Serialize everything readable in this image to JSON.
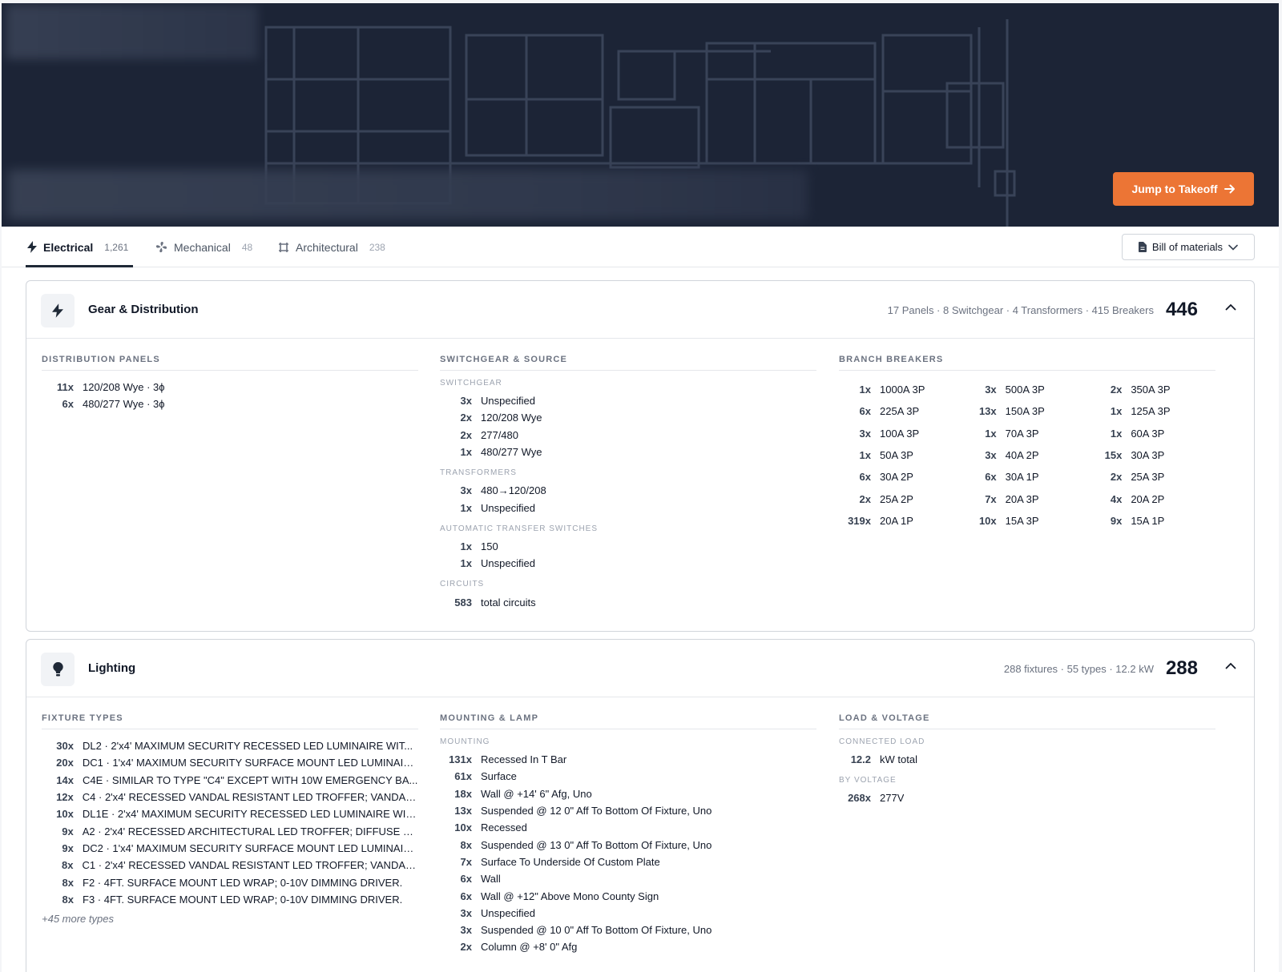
{
  "hero": {
    "jump_label": "Jump to Takeoff"
  },
  "tabs": [
    {
      "label": "Electrical",
      "count": "1,261"
    },
    {
      "label": "Mechanical",
      "count": "48"
    },
    {
      "label": "Architectural",
      "count": "238"
    }
  ],
  "bom_label": "Bill of materials",
  "gear": {
    "title": "Gear & Distribution",
    "summary": "17 Panels · 8 Switchgear · 4 Transformers · 415 Breakers",
    "total": "446",
    "panels_title": "DISTRIBUTION PANELS",
    "panels": [
      {
        "q": "11x",
        "l": "120/208 Wye · 3ϕ"
      },
      {
        "q": "6x",
        "l": "480/277 Wye · 3ϕ"
      }
    ],
    "switch_title": "SWITCHGEAR & SOURCE",
    "switchgear_sub": "SWITCHGEAR",
    "switchgear": [
      {
        "q": "3x",
        "l": "Unspecified"
      },
      {
        "q": "2x",
        "l": "120/208 Wye"
      },
      {
        "q": "2x",
        "l": "277/480"
      },
      {
        "q": "1x",
        "l": "480/277 Wye"
      }
    ],
    "transformers_sub": "TRANSFORMERS",
    "transformers": [
      {
        "q": "3x",
        "l": "480→120/208"
      },
      {
        "q": "1x",
        "l": "Unspecified"
      }
    ],
    "ats_sub": "AUTOMATIC TRANSFER SWITCHES",
    "ats": [
      {
        "q": "1x",
        "l": "150"
      },
      {
        "q": "1x",
        "l": "Unspecified"
      }
    ],
    "circuits_sub": "CIRCUITS",
    "circuits": [
      {
        "q": "583",
        "l": "total circuits"
      }
    ],
    "breakers_title": "BRANCH BREAKERS",
    "breakers": [
      {
        "q": "1x",
        "l": "1000A 3P"
      },
      {
        "q": "3x",
        "l": "500A 3P"
      },
      {
        "q": "2x",
        "l": "350A 3P"
      },
      {
        "q": "6x",
        "l": "225A 3P"
      },
      {
        "q": "13x",
        "l": "150A 3P"
      },
      {
        "q": "1x",
        "l": "125A 3P"
      },
      {
        "q": "3x",
        "l": "100A 3P"
      },
      {
        "q": "1x",
        "l": "70A 3P"
      },
      {
        "q": "1x",
        "l": "60A 3P"
      },
      {
        "q": "1x",
        "l": "50A 3P"
      },
      {
        "q": "3x",
        "l": "40A 2P"
      },
      {
        "q": "15x",
        "l": "30A 3P"
      },
      {
        "q": "6x",
        "l": "30A 2P"
      },
      {
        "q": "6x",
        "l": "30A 1P"
      },
      {
        "q": "2x",
        "l": "25A 3P"
      },
      {
        "q": "2x",
        "l": "25A 2P"
      },
      {
        "q": "7x",
        "l": "20A 3P"
      },
      {
        "q": "4x",
        "l": "20A 2P"
      },
      {
        "q": "319x",
        "l": "20A 1P"
      },
      {
        "q": "10x",
        "l": "15A 3P"
      },
      {
        "q": "9x",
        "l": "15A 1P"
      }
    ]
  },
  "lighting": {
    "title": "Lighting",
    "summary": "288 fixtures · 55 types · 12.2 kW",
    "total": "288",
    "fixtures_title": "FIXTURE TYPES",
    "fixtures": [
      {
        "q": "30x",
        "l": "DL2 · 2'x4' MAXIMUM SECURITY RECESSED LED LUMINAIRE WIT..."
      },
      {
        "q": "20x",
        "l": "DC1 · 1'x4' MAXIMUM SECURITY SURFACE MOUNT LED LUMINAIR..."
      },
      {
        "q": "14x",
        "l": "C4E · SIMILAR TO TYPE \"C4\" EXCEPT WITH 10W EMERGENCY BA..."
      },
      {
        "q": "12x",
        "l": "C4 · 2'x4' RECESSED VANDAL RESISTANT LED TROFFER; VANDAL..."
      },
      {
        "q": "10x",
        "l": "DL1E · 2'x4' MAXIMUM SECURITY RECESSED LED LUMINAIRE WIT..."
      },
      {
        "q": "9x",
        "l": "A2 · 2'x4' RECESSED ARCHITECTURAL LED TROFFER; DIFFUSE M..."
      },
      {
        "q": "9x",
        "l": "DC2 · 1'x4' MAXIMUM SECURITY SURFACE MOUNT LED LUMINAIR..."
      },
      {
        "q": "8x",
        "l": "C1 · 2'x4' RECESSED VANDAL RESISTANT LED TROFFER; VANDAL ..."
      },
      {
        "q": "8x",
        "l": "F2 · 4FT. SURFACE MOUNT LED WRAP; 0-10V DIMMING DRIVER."
      },
      {
        "q": "8x",
        "l": "F3 · 4FT. SURFACE MOUNT LED WRAP; 0-10V DIMMING DRIVER."
      }
    ],
    "more_types": "+45 more types",
    "mounting_title": "MOUNTING & LAMP",
    "mounting_sub": "MOUNTING",
    "mounting": [
      {
        "q": "131x",
        "l": "Recessed In T Bar"
      },
      {
        "q": "61x",
        "l": "Surface"
      },
      {
        "q": "18x",
        "l": "Wall @ +14' 6\" Afg, Uno"
      },
      {
        "q": "13x",
        "l": "Suspended @ 12 0\" Aff To Bottom Of Fixture, Uno"
      },
      {
        "q": "10x",
        "l": "Recessed"
      },
      {
        "q": "8x",
        "l": "Suspended @ 13 0\" Aff To Bottom Of Fixture, Uno"
      },
      {
        "q": "7x",
        "l": "Surface To Underside Of Custom Plate"
      },
      {
        "q": "6x",
        "l": "Wall"
      },
      {
        "q": "6x",
        "l": "Wall @ +12\" Above Mono County Sign"
      },
      {
        "q": "3x",
        "l": "Unspecified"
      },
      {
        "q": "3x",
        "l": "Suspended @ 10 0\" Aff To Bottom Of Fixture, Uno"
      },
      {
        "q": "2x",
        "l": "Column @ +8' 0\" Afg"
      }
    ],
    "load_title": "LOAD & VOLTAGE",
    "connected_sub": "CONNECTED LOAD",
    "connected": [
      {
        "q": "12.2",
        "l": "kW total"
      }
    ],
    "voltage_sub": "BY VOLTAGE",
    "voltage": [
      {
        "q": "268x",
        "l": "277V"
      }
    ]
  },
  "colors": {
    "accent": "#ec7535",
    "hero_bg": "#1c2436"
  }
}
